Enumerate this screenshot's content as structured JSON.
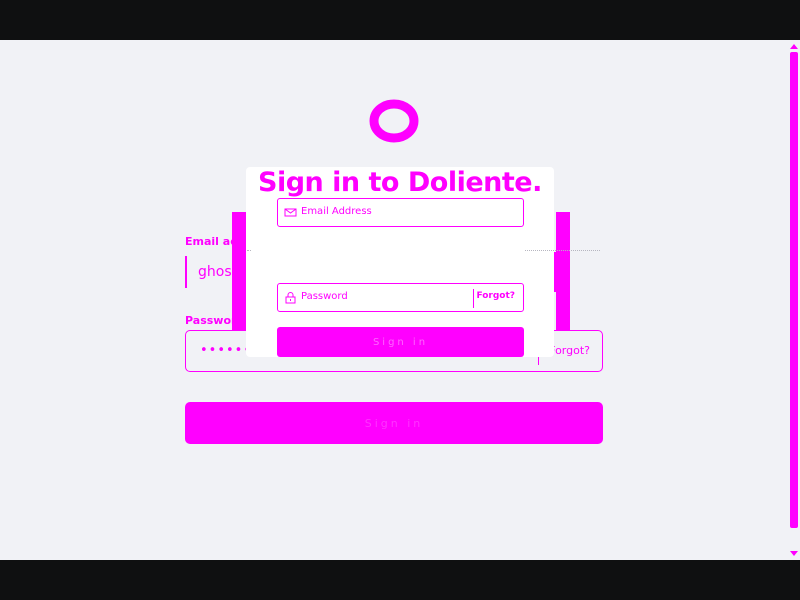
{
  "logo": {
    "icon": "circle-logo-icon",
    "color": "#ff00ff"
  },
  "card": {
    "title": "Sign in to Doliente.",
    "email_placeholder": "Email Address",
    "email_icon": "mail-icon",
    "password_placeholder": "Password",
    "password_icon": "lock-icon",
    "forgot_label": "Forgot?",
    "signin_label": "Sign in"
  },
  "form": {
    "email_label": "Email address",
    "email_value": "ghostauthor@example.com",
    "password_label": "Password",
    "password_value": "••••••••••",
    "forgot_label": "Forgot?",
    "signin_label": "Sign in"
  },
  "colors": {
    "accent": "#ff00ff",
    "background": "#f1f2f6",
    "letterbox": "#0f1011",
    "card": "#ffffff"
  }
}
